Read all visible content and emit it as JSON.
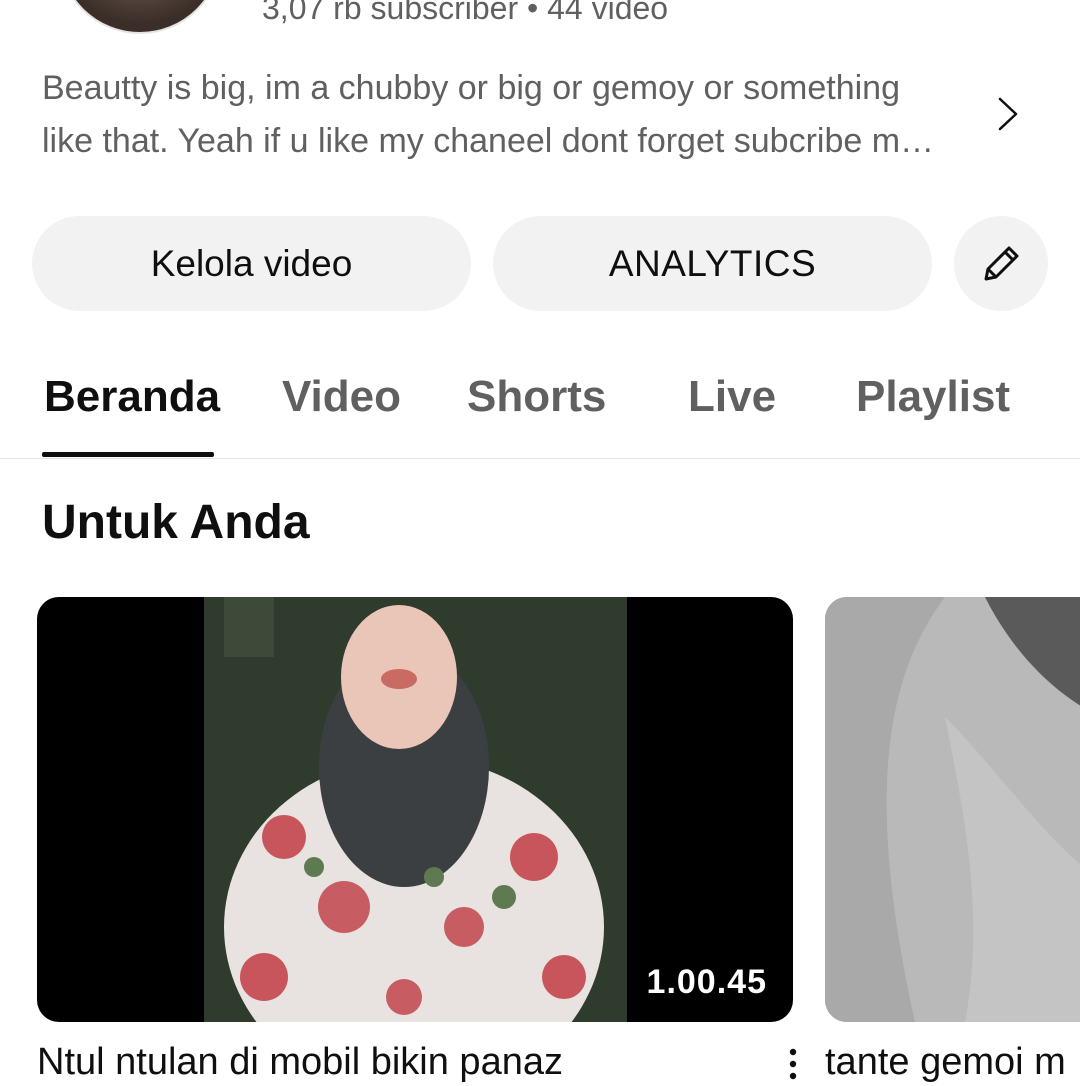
{
  "channel": {
    "stats": "3,07 rb subscriber • 44 video",
    "description_line1": "Beautty is big, im a chubby or big or gemoy or something",
    "description_line2": "like that. Yeah if u like my chaneel dont forget subcribe m…"
  },
  "actions": {
    "manage_label": "Kelola video",
    "analytics_label": "ANALYTICS",
    "edit_icon": "pencil-icon"
  },
  "tabs": [
    {
      "label": "Beranda",
      "active": true
    },
    {
      "label": "Video",
      "active": false
    },
    {
      "label": "Shorts",
      "active": false
    },
    {
      "label": "Live",
      "active": false
    },
    {
      "label": "Playlist",
      "active": false
    }
  ],
  "section": {
    "title": "Untuk Anda"
  },
  "videos": [
    {
      "title": "Ntul ntulan di mobil bikin panaz",
      "duration": "1.00.45"
    },
    {
      "title": "tante gemoi m"
    }
  ],
  "colors": {
    "text_primary": "#0f0f0f",
    "text_secondary": "#606060",
    "pill_background": "#f2f2f2"
  }
}
